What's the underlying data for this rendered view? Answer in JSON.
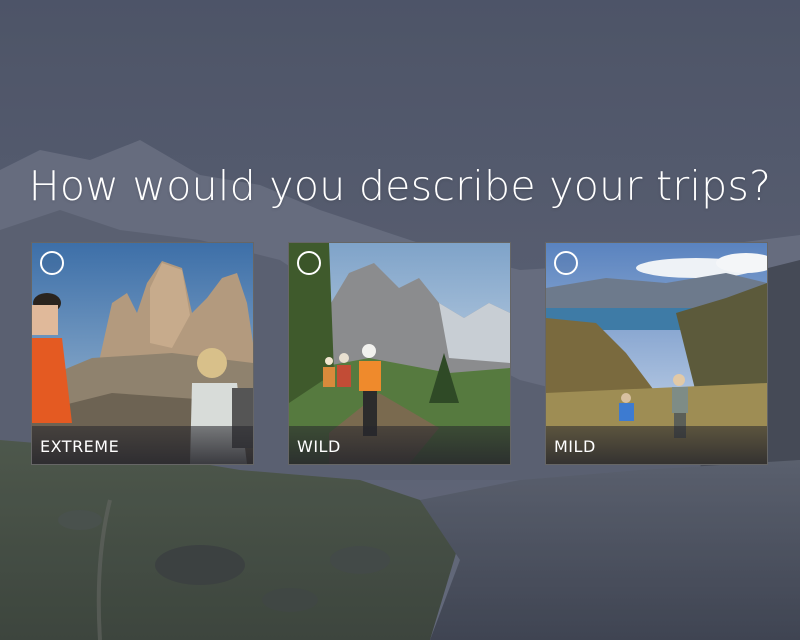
{
  "question": "How would you describe your trips?",
  "options": [
    {
      "label": "EXTREME",
      "selected": false
    },
    {
      "label": "WILD",
      "selected": false
    },
    {
      "label": "MILD",
      "selected": false
    }
  ],
  "colors": {
    "text": "#ffffff",
    "footer": "#26262c"
  }
}
